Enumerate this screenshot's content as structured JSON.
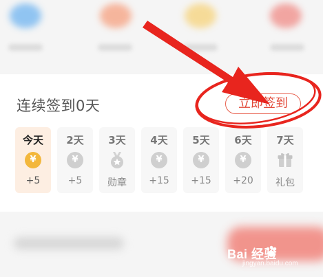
{
  "signin": {
    "title": "连续签到0天",
    "button_label": "立即签到"
  },
  "days": [
    {
      "label": "今天",
      "reward": "+5",
      "icon": "coin-icon",
      "today": true
    },
    {
      "label": "2天",
      "reward": "+5",
      "icon": "coin-icon"
    },
    {
      "label": "3天",
      "reward": "勋章",
      "icon": "medal-icon"
    },
    {
      "label": "4天",
      "reward": "+15",
      "icon": "coin-icon"
    },
    {
      "label": "5天",
      "reward": "+15",
      "icon": "coin-icon"
    },
    {
      "label": "6天",
      "reward": "+20",
      "icon": "coin-icon"
    },
    {
      "label": "7天",
      "reward": "礼包",
      "icon": "gift-icon"
    }
  ],
  "coin_symbol": "¥",
  "watermark": {
    "brand": "Bai  经验",
    "url": "jingyan.baidu.com"
  },
  "colors": {
    "accent": "#e24a3a",
    "annotation": "#e8251e",
    "today_bg": "#fdeee2",
    "coin_gold": "#f3b73c"
  }
}
